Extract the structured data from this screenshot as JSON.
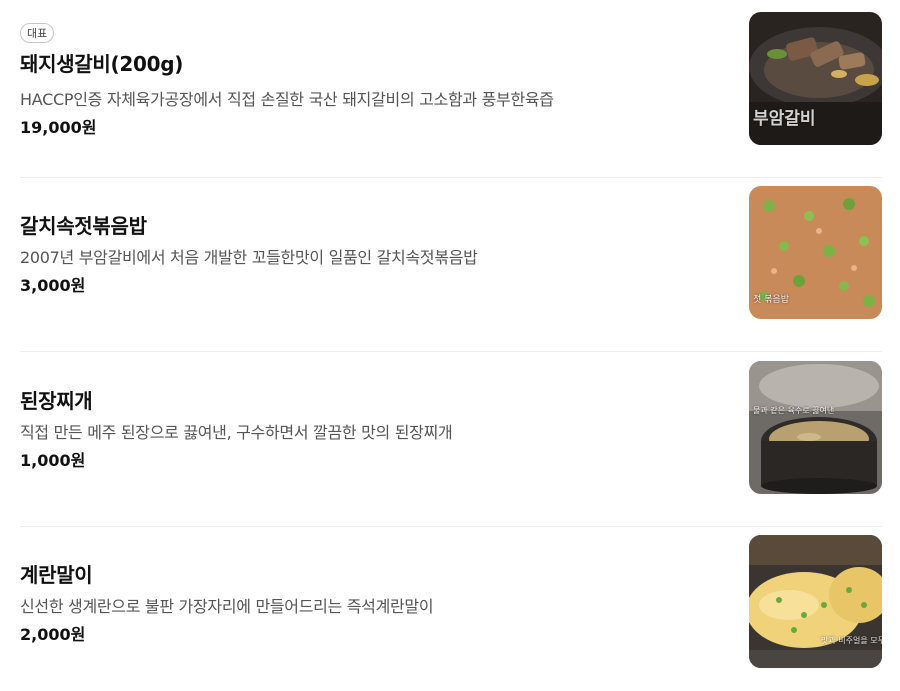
{
  "menu": {
    "items": [
      {
        "badge": "대표",
        "name": "돼지생갈비(200g)",
        "description": "HACCP인증 자체육가공장에서 직접 손질한 국산 돼지갈비의 고소함과 풍부한육즙",
        "price": "19,000원",
        "image_caption": "부암갈비"
      },
      {
        "name": "갈치속젓볶음밥",
        "description": "2007년 부암갈비에서 처음 개발한 꼬들한맛이 일품인 갈치속젓볶음밥",
        "price": "3,000원",
        "image_caption": "젓 볶음밥"
      },
      {
        "name": "된장찌개",
        "description": "직접 만든 메주 된장으로 끓여낸, 구수하면서 깔끔한 맛의 된장찌개",
        "price": "1,000원",
        "image_caption": "물과 같은 육수로 끓여낸"
      },
      {
        "name": "계란말이",
        "description": "신선한 생계란으로 불판 가장자리에 만들어드리는 즉석계란말이",
        "price": "2,000원",
        "image_caption": "맛과 비주얼을 모두"
      }
    ]
  }
}
